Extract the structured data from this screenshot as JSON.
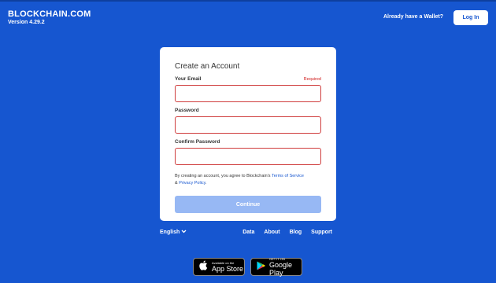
{
  "header": {
    "brand_name": "BLOCKCHAIN.COM",
    "version": "Version 4.29.2",
    "have_wallet_text": "Already have a Wallet?",
    "login_label": "Log In"
  },
  "card": {
    "title": "Create an Account",
    "fields": [
      {
        "label": "Your Email",
        "badge": "Required",
        "value": ""
      },
      {
        "label": "Password",
        "value": ""
      },
      {
        "label": "Confirm Password",
        "value": ""
      }
    ],
    "terms": {
      "prefix": "By creating an account, you agree to Blockchain's ",
      "tos_link": "Terms of Service",
      "amp": " & ",
      "privacy_link": "Privacy Policy",
      "suffix": "."
    },
    "continue_label": "Continue"
  },
  "footer": {
    "language": "English",
    "links": [
      "Data",
      "About",
      "Blog",
      "Support"
    ]
  },
  "stores": {
    "appstore_small": "Available on the",
    "appstore_big": "App Store",
    "googleplay_small": "GET IT ON",
    "googleplay_big": "Google Play"
  },
  "colors": {
    "background": "#1656d0",
    "error_border": "#cf3c3c",
    "continue_disabled": "#97b8f4"
  }
}
